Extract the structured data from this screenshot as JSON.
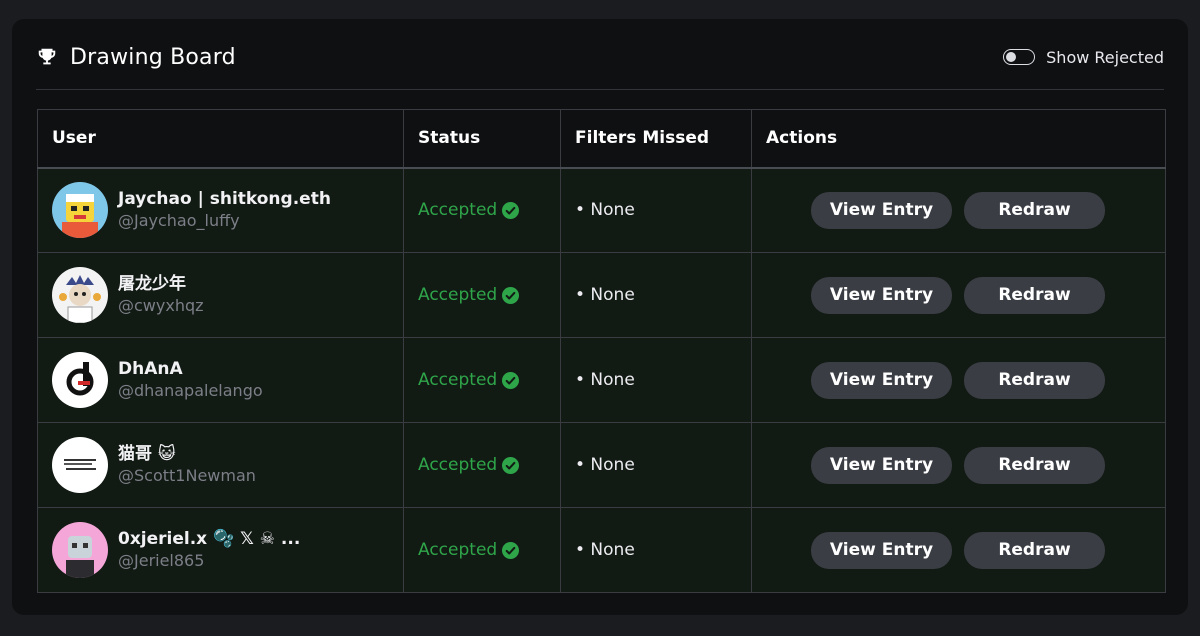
{
  "header": {
    "title": "Drawing Board",
    "trophy_icon": "trophy-icon",
    "toggle_label": "Show Rejected",
    "toggle_on": false
  },
  "table": {
    "columns": [
      "User",
      "Status",
      "Filters Missed",
      "Actions"
    ],
    "rows": [
      {
        "name": "Jaychao | shitkong.eth",
        "handle": "@Jaychao_luffy",
        "status": "Accepted",
        "filters": "• None",
        "view_label": "View Entry",
        "redraw_label": "Redraw"
      },
      {
        "name": "屠龙少年",
        "handle": "@cwyxhqz",
        "status": "Accepted",
        "filters": "• None",
        "view_label": "View Entry",
        "redraw_label": "Redraw"
      },
      {
        "name": "DhAnA",
        "handle": "@dhanapalelango",
        "status": "Accepted",
        "filters": "• None",
        "view_label": "View Entry",
        "redraw_label": "Redraw"
      },
      {
        "name": "猫哥 😺",
        "handle": "@Scott1Newman",
        "status": "Accepted",
        "filters": "• None",
        "view_label": "View Entry",
        "redraw_label": "Redraw"
      },
      {
        "name": "0xjeriel.x 🫧 𝕏 ☠ ...",
        "handle": "@Jeriel865",
        "status": "Accepted",
        "filters": "• None",
        "view_label": "View Entry",
        "redraw_label": "Redraw"
      }
    ]
  },
  "colors": {
    "accepted": "#2fa54a",
    "button_bg": "#3a3d44",
    "row_bg": "#121a14"
  }
}
